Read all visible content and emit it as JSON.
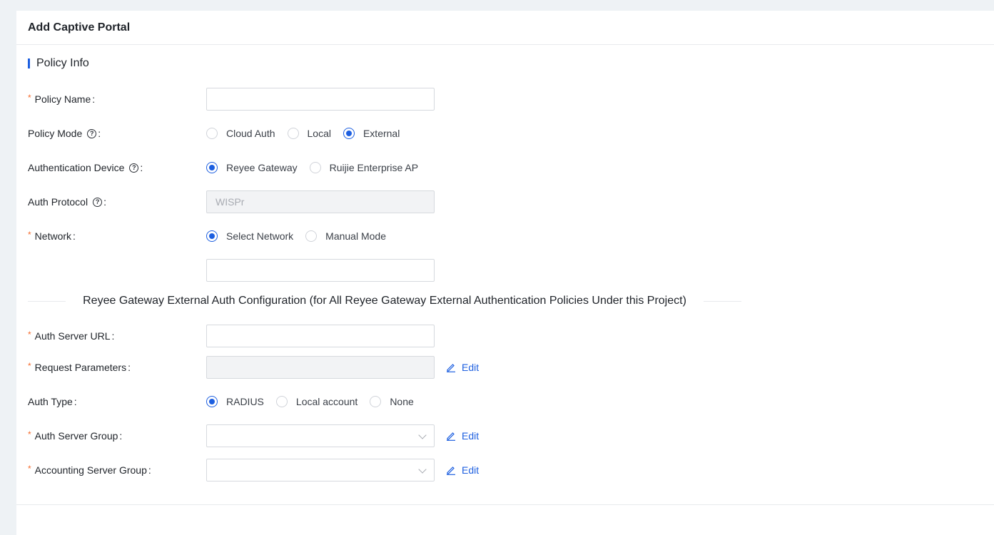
{
  "panel": {
    "title": "Add Captive Portal"
  },
  "section": {
    "title": "Policy Info"
  },
  "policy_name": {
    "label": "Policy Name",
    "value": "",
    "placeholder": ""
  },
  "policy_mode": {
    "label": "Policy Mode",
    "options": [
      "Cloud Auth",
      "Local",
      "External"
    ],
    "selected": "External"
  },
  "auth_device": {
    "label": "Authentication Device",
    "options": [
      "Reyee Gateway",
      "Ruijie Enterprise AP"
    ],
    "selected": "Reyee Gateway"
  },
  "auth_protocol": {
    "label": "Auth Protocol",
    "value": "WISPr"
  },
  "network": {
    "label": "Network",
    "options": [
      "Select Network",
      "Manual Mode"
    ],
    "selected": "Select Network",
    "value": ""
  },
  "divider": {
    "text": "Reyee Gateway External Auth Configuration (for All Reyee Gateway External Authentication Policies Under this Project)"
  },
  "auth_server_url": {
    "label": "Auth Server URL",
    "value": ""
  },
  "request_params": {
    "label": "Request Parameters",
    "value": "",
    "edit_label": "Edit"
  },
  "auth_type": {
    "label": "Auth Type",
    "options": [
      "RADIUS",
      "Local account",
      "None"
    ],
    "selected": "RADIUS"
  },
  "auth_server_group": {
    "label": "Auth Server Group",
    "value": "",
    "edit_label": "Edit"
  },
  "accounting_server_group": {
    "label": "Accounting Server Group",
    "value": "",
    "edit_label": "Edit"
  },
  "colors": {
    "accent": "#1d5fe0",
    "required": "#f56c2d"
  }
}
